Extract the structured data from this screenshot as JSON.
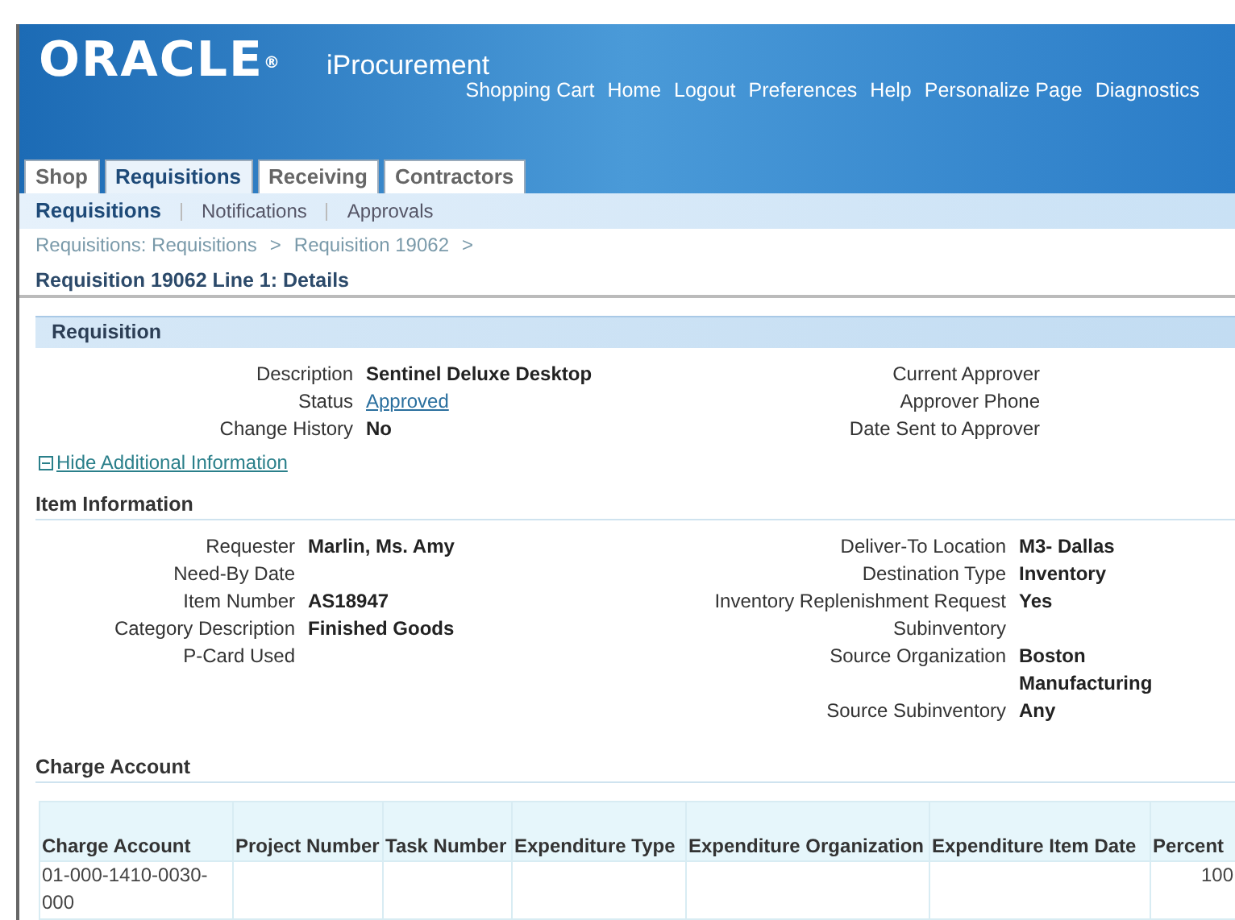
{
  "header": {
    "logo": "ORACLE",
    "logo_mark": "®",
    "app_name": "iProcurement",
    "global_links": [
      "Shopping Cart",
      "Home",
      "Logout",
      "Preferences",
      "Help",
      "Personalize Page",
      "Diagnostics"
    ]
  },
  "tabs": [
    {
      "label": "Shop",
      "selected": false
    },
    {
      "label": "Requisitions",
      "selected": true
    },
    {
      "label": "Receiving",
      "selected": false
    },
    {
      "label": "Contractors",
      "selected": false
    }
  ],
  "subtabs": [
    {
      "label": "Requisitions",
      "selected": true
    },
    {
      "label": "Notifications",
      "selected": false
    },
    {
      "label": "Approvals",
      "selected": false
    }
  ],
  "breadcrumbs": [
    "Requisitions: Requisitions",
    "Requisition 19062"
  ],
  "breadcrumb_separator": ">",
  "page_title": "Requisition 19062 Line 1: Details",
  "requisition": {
    "title": "Requisition",
    "left_fields": [
      {
        "label": "Description",
        "value": "Sentinel Deluxe Desktop",
        "kind": "text"
      },
      {
        "label": "Status",
        "value": "Approved",
        "kind": "link"
      },
      {
        "label": "Change History",
        "value": "No",
        "kind": "text"
      }
    ],
    "right_fields": [
      {
        "label": "Current Approver"
      },
      {
        "label": "Approver Phone"
      },
      {
        "label": "Date Sent to Approver"
      }
    ],
    "toggle": {
      "label": "Hide Additional Information",
      "expanded": true
    }
  },
  "item_information": {
    "title": "Item Information",
    "left_fields": [
      {
        "label": "Requester",
        "value": "Marlin, Ms. Amy"
      },
      {
        "label": "Need-By Date"
      },
      {
        "label": "Item Number",
        "value": "AS18947"
      },
      {
        "label": "Category Description",
        "value": "Finished Goods"
      },
      {
        "label": "P-Card Used"
      }
    ],
    "right_fields": [
      {
        "label": "Deliver-To Location",
        "value": "M3- Dallas"
      },
      {
        "label": "Destination Type",
        "value": "Inventory"
      },
      {
        "label": "Inventory Replenishment Request",
        "value": "Yes"
      },
      {
        "label": "Subinventory"
      },
      {
        "label": "Source Organization",
        "value": "Boston Manufacturing"
      },
      {
        "label": "Source Subinventory",
        "value": "Any"
      }
    ]
  },
  "charge_account": {
    "title": "Charge Account",
    "columns": [
      "Charge Account",
      "Project Number",
      "Task Number",
      "Expenditure Type",
      "Expenditure Organization",
      "Expenditure Item Date",
      "Percent"
    ],
    "rows": [
      {
        "charge_account": "01-000-1410-0030-000",
        "percent": "100"
      }
    ]
  }
}
